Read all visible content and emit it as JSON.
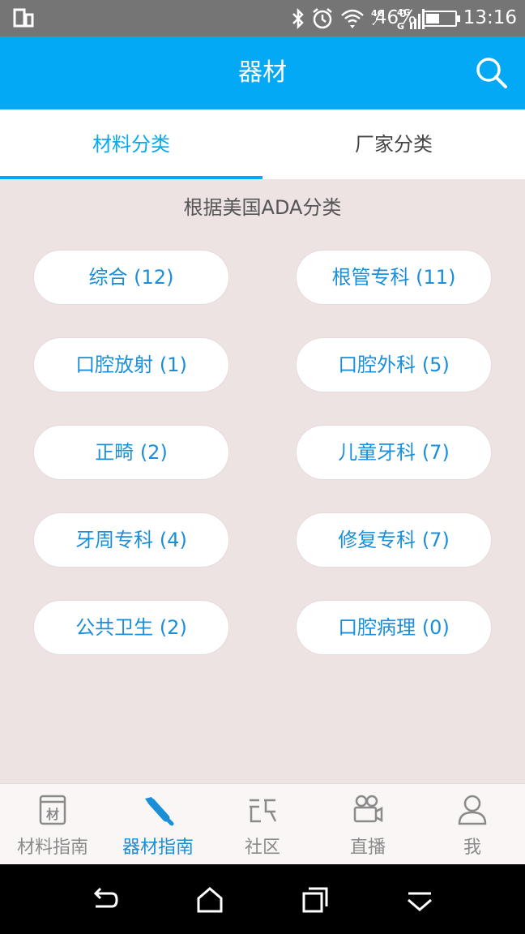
{
  "status_bar": {
    "battery_percent": "46%",
    "time": "13:16",
    "network_labels": [
      "4G",
      "4G"
    ],
    "icons": [
      "screen-icon",
      "bluetooth-icon",
      "alarm-icon",
      "wifi-icon",
      "signal-icon",
      "battery-icon"
    ]
  },
  "app_bar": {
    "title": "器材",
    "search_icon": "search-icon"
  },
  "tabs": [
    {
      "label": "材料分类",
      "active": true
    },
    {
      "label": "厂家分类",
      "active": false
    }
  ],
  "subtitle": "根据美国ADA分类",
  "categories": [
    {
      "label": "综合 (12)"
    },
    {
      "label": "根管专科 (11)"
    },
    {
      "label": "口腔放射 (1)"
    },
    {
      "label": "口腔外科 (5)"
    },
    {
      "label": "正畸 (2)"
    },
    {
      "label": "儿童牙科 (7)"
    },
    {
      "label": "牙周专科 (4)"
    },
    {
      "label": "修复专科 (7)"
    },
    {
      "label": "公共卫生 (2)"
    },
    {
      "label": "口腔病理 (0)"
    }
  ],
  "bottom_nav": [
    {
      "label": "材料指南",
      "icon": "book-icon",
      "active": false
    },
    {
      "label": "器材指南",
      "icon": "handpiece-icon",
      "active": true
    },
    {
      "label": "社区",
      "icon": "community-icon",
      "active": false
    },
    {
      "label": "直播",
      "icon": "video-camera-icon",
      "active": false
    },
    {
      "label": "我",
      "icon": "person-icon",
      "active": false
    }
  ],
  "system_nav": [
    "back-icon",
    "home-icon",
    "recents-icon",
    "hide-icon"
  ],
  "colors": {
    "accent": "#03a9f4",
    "background": "#ede3e3",
    "button_text": "#1a8fd8"
  }
}
